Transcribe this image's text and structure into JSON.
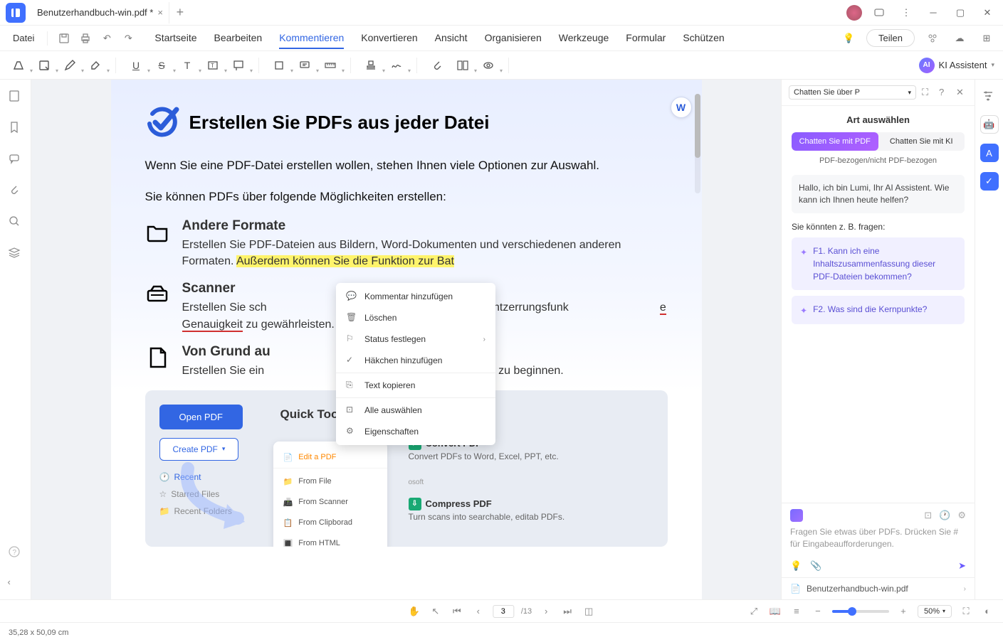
{
  "titlebar": {
    "tab": "Benutzerhandbuch-win.pdf *"
  },
  "menubar": {
    "file": "Datei",
    "tabs": [
      "Startseite",
      "Bearbeiten",
      "Kommentieren",
      "Konvertieren",
      "Ansicht",
      "Organisieren",
      "Werkzeuge",
      "Formular",
      "Schützen"
    ],
    "active_index": 2,
    "share": "Teilen"
  },
  "toolbar": {
    "ai": "KI Assistent"
  },
  "page": {
    "h1": "Erstellen Sie PDFs aus jeder Datei",
    "p1": "Wenn Sie eine PDF-Datei erstellen wollen, stehen Ihnen viele Optionen zur Auswahl.",
    "p2": "Sie können PDFs über folgende Möglichkeiten erstellen:",
    "f1h": "Andere Formate",
    "f1a": "Erstellen Sie PDF-Dateien aus Bildern, Word-Dokumenten und verschiedenen anderen Formaten. ",
    "f1hl": "Außerdem können Sie die Funktion zur Bat",
    "f2h": "Scanner",
    "f2a": "Erstellen Sie sch",
    "f2b": "er, indem Sie die Entzerrungsfunk",
    "f2red": "e Genauigkeit",
    "f2c": " zu gewährleisten.",
    "f3h": "Von Grund au",
    "f3a": "Erstellen Sie ein",
    "f3b": "und auf neu zu beginnen."
  },
  "quick": {
    "title": "Quick Tools",
    "open": "Open PDF",
    "create": "Create PDF",
    "recent": "Recent",
    "starred": "Starred Files",
    "folders": "Recent Folders",
    "dd": [
      "From File",
      "From Scanner",
      "From Clipborad",
      "From HTML"
    ],
    "conv_h": "Convert PDF",
    "conv_p": "Convert PDFs to Word, Excel, PPT, etc.",
    "comp_h": "Compress PDF",
    "comp_p": "Turn scans into searchable, editab PDFs.",
    "osoft": "osoft"
  },
  "context": {
    "items": [
      "Kommentar hinzufügen",
      "Löschen",
      "Status festlegen",
      "Häkchen hinzufügen",
      "Text kopieren",
      "Alle auswählen",
      "Eigenschaften"
    ]
  },
  "ai": {
    "select": "Chatten Sie über P",
    "art": "Art auswählen",
    "seg1": "Chatten Sie mit PDF",
    "seg2": "Chatten Sie mit KI",
    "sub": "PDF-bezogen/nicht PDF-bezogen",
    "greet": "Hallo, ich bin Lumi, Ihr AI Assistent. Wie kann ich Ihnen heute helfen?",
    "sugg_h": "Sie könnten z. B. fragen:",
    "s1": "F1. Kann ich eine Inhaltszusammenfassung dieser PDF-Dateien bekommen?",
    "s2": "F2. Was sind die Kernpunkte?",
    "input_ph": "Fragen Sie etwas über PDFs. Drücken Sie # für Eingabeaufforderungen.",
    "file": "Benutzerhandbuch-win.pdf"
  },
  "viewbar": {
    "page": "3",
    "total": "/13",
    "zoom": "50%"
  },
  "statusbar": {
    "coords": "35,28 x 50,09 cm"
  }
}
